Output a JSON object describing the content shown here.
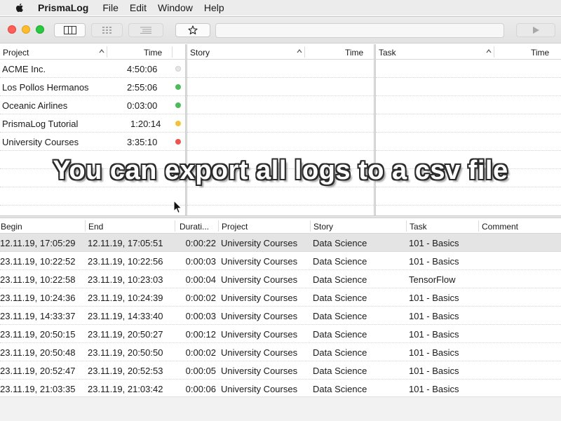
{
  "menubar": {
    "app_name": "PrismaLog",
    "items": [
      "File",
      "Edit",
      "Window",
      "Help"
    ]
  },
  "toolbar": {
    "search_value": ""
  },
  "projects": {
    "col_project": "Project",
    "col_time": "Time",
    "rows": [
      {
        "name": "ACME Inc.",
        "time": "4:50:06",
        "status_color": "#e6e6e6"
      },
      {
        "name": "Los Pollos Hermanos",
        "time": "2:55:06",
        "status_color": "#4cbb5a"
      },
      {
        "name": "Oceanic Airlines",
        "time": "0:03:00",
        "status_color": "#4cbb5a"
      },
      {
        "name": "PrismaLog Tutorial",
        "time": "1:20:14",
        "status_color": "#f2c23a"
      },
      {
        "name": "University Courses",
        "time": "3:35:10",
        "status_color": "#e8564f"
      }
    ]
  },
  "stories": {
    "col_story": "Story",
    "col_time": "Time"
  },
  "tasks": {
    "col_task": "Task",
    "col_time": "Time"
  },
  "caption": "You can export all logs to a csv file",
  "logs": {
    "columns": {
      "begin": "Begin",
      "end": "End",
      "duration": "Durati...",
      "project": "Project",
      "story": "Story",
      "task": "Task",
      "comment": "Comment"
    },
    "rows": [
      {
        "begin": "12.11.19, 17:05:29",
        "end": "12.11.19, 17:05:51",
        "duration": "0:00:22",
        "project": "University Courses",
        "story": "Data Science",
        "task": "101 - Basics",
        "comment": ""
      },
      {
        "begin": "23.11.19, 10:22:52",
        "end": "23.11.19, 10:22:56",
        "duration": "0:00:03",
        "project": "University Courses",
        "story": "Data Science",
        "task": "101 - Basics",
        "comment": ""
      },
      {
        "begin": "23.11.19, 10:22:58",
        "end": "23.11.19, 10:23:03",
        "duration": "0:00:04",
        "project": "University Courses",
        "story": "Data Science",
        "task": "TensorFlow",
        "comment": ""
      },
      {
        "begin": "23.11.19, 10:24:36",
        "end": "23.11.19, 10:24:39",
        "duration": "0:00:02",
        "project": "University Courses",
        "story": "Data Science",
        "task": "101 - Basics",
        "comment": ""
      },
      {
        "begin": "23.11.19, 14:33:37",
        "end": "23.11.19, 14:33:40",
        "duration": "0:00:03",
        "project": "University Courses",
        "story": "Data Science",
        "task": "101 - Basics",
        "comment": ""
      },
      {
        "begin": "23.11.19, 20:50:15",
        "end": "23.11.19, 20:50:27",
        "duration": "0:00:12",
        "project": "University Courses",
        "story": "Data Science",
        "task": "101 - Basics",
        "comment": ""
      },
      {
        "begin": "23.11.19, 20:50:48",
        "end": "23.11.19, 20:50:50",
        "duration": "0:00:02",
        "project": "University Courses",
        "story": "Data Science",
        "task": "101 - Basics",
        "comment": ""
      },
      {
        "begin": "23.11.19, 20:52:47",
        "end": "23.11.19, 20:52:53",
        "duration": "0:00:05",
        "project": "University Courses",
        "story": "Data Science",
        "task": "101 - Basics",
        "comment": ""
      },
      {
        "begin": "23.11.19, 21:03:35",
        "end": "23.11.19, 21:03:42",
        "duration": "0:00:06",
        "project": "University Courses",
        "story": "Data Science",
        "task": "101 - Basics",
        "comment": ""
      }
    ]
  }
}
